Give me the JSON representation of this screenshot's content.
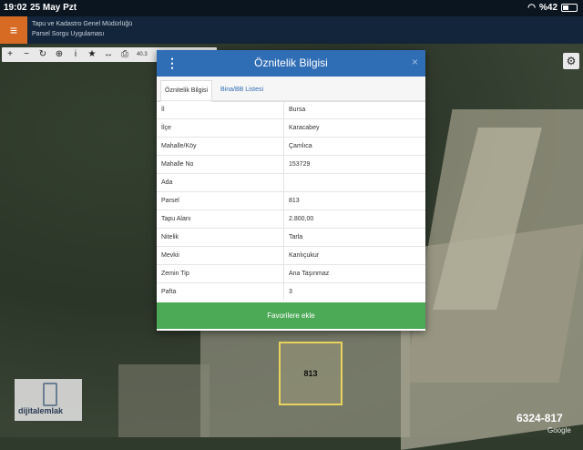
{
  "status_bar": {
    "time": "19:02",
    "date": "25 May Pzt",
    "battery": "%42"
  },
  "app_header": {
    "menu_icon": "≡",
    "org_name": "Tapu ve Kadastro Genel Müdürlüğü",
    "app_name": "Parsel Sorgu Uygulaması"
  },
  "toolbar": {
    "tools": [
      {
        "name": "zoom-in-icon",
        "glyph": "+"
      },
      {
        "name": "zoom-out-icon",
        "glyph": "−"
      },
      {
        "name": "refresh-icon",
        "glyph": "↻"
      },
      {
        "name": "locate-icon",
        "glyph": "⊕"
      },
      {
        "name": "info-icon",
        "glyph": "i"
      },
      {
        "name": "star-icon",
        "glyph": "★"
      },
      {
        "name": "measure-icon",
        "glyph": "↔"
      },
      {
        "name": "print-icon",
        "glyph": "⎙"
      }
    ],
    "coord": "40.3"
  },
  "settings_icon": "⚙",
  "modal": {
    "title": "Öznitelik Bilgisi",
    "menu_icon": "⋮",
    "close_icon": "×",
    "tabs": [
      "Öznitelik Bilgisi",
      "Bina/BB Listesi"
    ],
    "rows": [
      {
        "key": "İl",
        "value": "Bursa"
      },
      {
        "key": "İlçe",
        "value": "Karacabey"
      },
      {
        "key": "Mahalle/Köy",
        "value": "Çamlıca"
      },
      {
        "key": "Mahalle No",
        "value": "153729"
      },
      {
        "key": "Ada",
        "value": ""
      },
      {
        "key": "Parsel",
        "value": "813"
      },
      {
        "key": "Tapu Alanı",
        "value": "2.800,00"
      },
      {
        "key": "Nitelik",
        "value": "Tarla"
      },
      {
        "key": "Mevkii",
        "value": "Kanlıçukur"
      },
      {
        "key": "Zemin Tip",
        "value": "Ana Taşınmaz"
      },
      {
        "key": "Pafta",
        "value": "3"
      }
    ],
    "favorite_button": "Favorilere ekle"
  },
  "parcel_label": "813",
  "watermark": {
    "text": "dijitalemlak"
  },
  "overlay_code": "6324-817",
  "map_attribution": "Google",
  "colors": {
    "header_blue": "#2f6db5",
    "accent_orange": "#d76b24",
    "button_green": "#4caa57"
  }
}
